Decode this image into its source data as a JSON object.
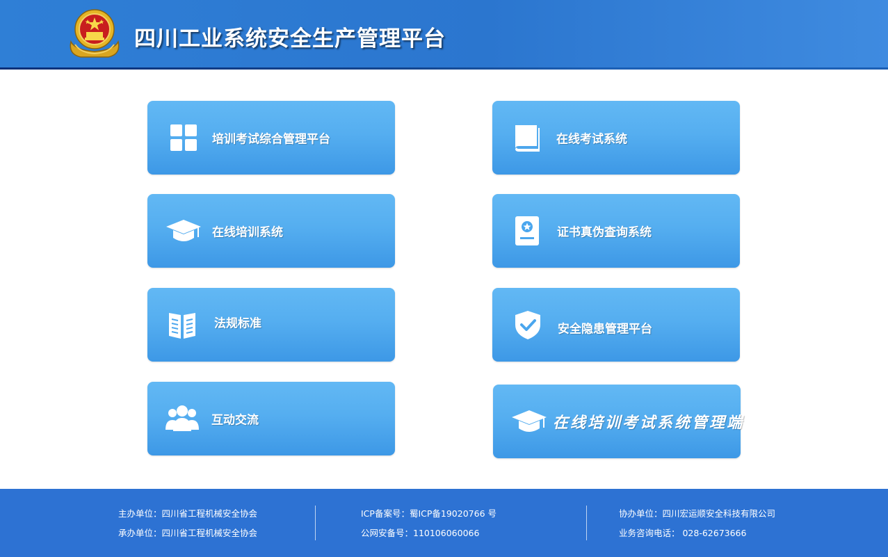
{
  "header": {
    "title": "四川工业系统安全生产管理平台"
  },
  "tiles": [
    {
      "label": "培训考试综合管理平台",
      "icon": "grid-icon"
    },
    {
      "label": "在线考试系统",
      "icon": "book-icon"
    },
    {
      "label": "在线培训系统",
      "icon": "graduation-cap-icon"
    },
    {
      "label": "证书真伪查询系统",
      "icon": "certificate-icon"
    },
    {
      "label": "法规标准",
      "icon": "open-book-icon"
    },
    {
      "label": "安全隐患管理平台",
      "icon": "shield-check-icon"
    },
    {
      "label": "互动交流",
      "icon": "users-icon"
    },
    {
      "label": "在线培训考试系统管理端",
      "icon": "graduation-cap-icon"
    }
  ],
  "footer": {
    "host": "主办单位：四川省工程机械安全协会",
    "organizer": "承办单位：四川省工程机械安全协会",
    "icp": "ICP备案号：蜀ICP备19020766 号",
    "police": "公网安备号：110106060066",
    "cohost": "协办单位：四川宏运顺安全科技有限公司",
    "phone": "业务咨询电话： 028-62673666"
  },
  "colors": {
    "header": "#2f7fd6",
    "tile": "#55aef0",
    "footer": "#2d72d3"
  }
}
